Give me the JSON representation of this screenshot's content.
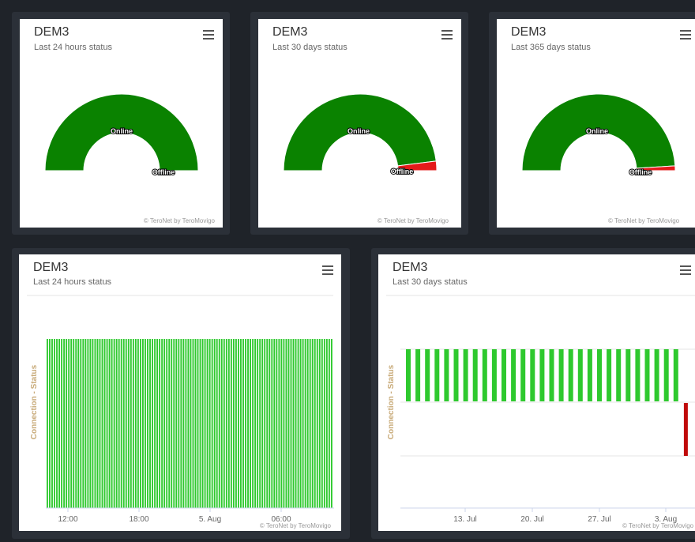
{
  "credits": "© TeroNet by TeroMovigo",
  "colors": {
    "online": "#0a8200",
    "offline": "#e41a1a",
    "bar_online": "#2ec92e",
    "bar_offline": "#c00a0a",
    "axis_title": "#c8aa78"
  },
  "gauges": [
    {
      "title": "DEM3",
      "subtitle": "Last 24 hours status",
      "online_label": "Online",
      "offline_label": "Offline"
    },
    {
      "title": "DEM3",
      "subtitle": "Last 30 days status",
      "online_label": "Online",
      "offline_label": "Offline"
    },
    {
      "title": "DEM3",
      "subtitle": "Last 365 days status",
      "online_label": "Online",
      "offline_label": "Offline"
    }
  ],
  "bar_charts": [
    {
      "title": "DEM3",
      "subtitle": "Last 24 hours status",
      "y_axis_title": "Connection - Status",
      "x_ticks": [
        "12:00",
        "18:00",
        "5. Aug",
        "06:00"
      ]
    },
    {
      "title": "DEM3",
      "subtitle": "Last 30 days status",
      "y_axis_title": "Connection - Status",
      "x_ticks": [
        "13. Jul",
        "20. Jul",
        "27. Jul",
        "3. Aug"
      ]
    }
  ],
  "chart_data": [
    {
      "type": "pie",
      "subtitle": "Last 24 hours status",
      "categories": [
        "Online",
        "Offline"
      ],
      "values": [
        100,
        0
      ]
    },
    {
      "type": "pie",
      "subtitle": "Last 30 days status",
      "categories": [
        "Online",
        "Offline"
      ],
      "values": [
        96,
        4
      ]
    },
    {
      "type": "pie",
      "subtitle": "Last 365 days status",
      "categories": [
        "Online",
        "Offline"
      ],
      "values": [
        98,
        2
      ]
    },
    {
      "type": "bar",
      "subtitle": "Last 24 hours status",
      "ylabel": "Connection - Status",
      "categories": [
        "12:00",
        "18:00",
        "5. Aug",
        "06:00"
      ],
      "online_bar_count": 120,
      "offline_bar_count": 0
    },
    {
      "type": "bar",
      "subtitle": "Last 30 days status",
      "ylabel": "Connection - Status",
      "categories": [
        "13. Jul",
        "20. Jul",
        "27. Jul",
        "3. Aug"
      ],
      "online_bar_count": 29,
      "offline_bar_count": 1
    }
  ]
}
